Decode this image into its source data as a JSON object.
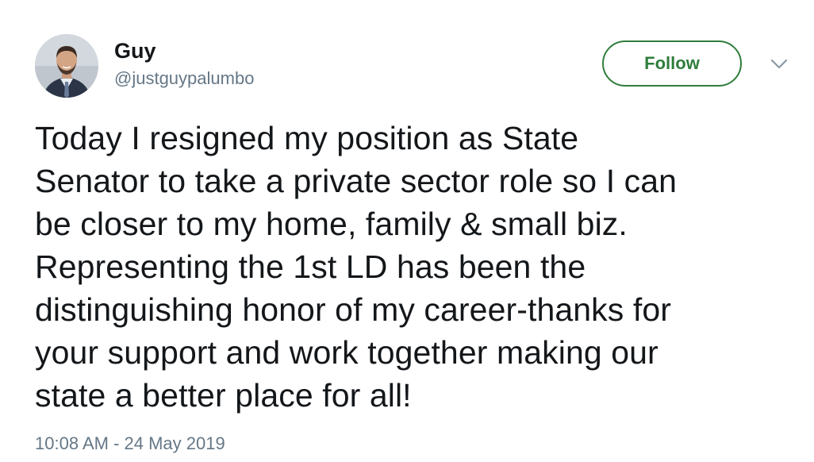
{
  "author": {
    "display_name": "Guy",
    "handle": "@justguypalumbo",
    "avatar_icon": "profile-photo"
  },
  "actions": {
    "follow_label": "Follow",
    "more_icon": "chevron-down-icon",
    "accent_color": "#2f7d3b"
  },
  "tweet": {
    "lines": [
      "Today I resigned my position as State",
      "Senator to take a private sector role so I can",
      "be closer to my home, family & small biz.",
      "Representing the 1st LD has been the",
      "distinguishing honor of my career-thanks for",
      "your support and work together making our",
      "state a better place for all!"
    ],
    "timestamp": "10:08 AM - 24 May 2019"
  }
}
